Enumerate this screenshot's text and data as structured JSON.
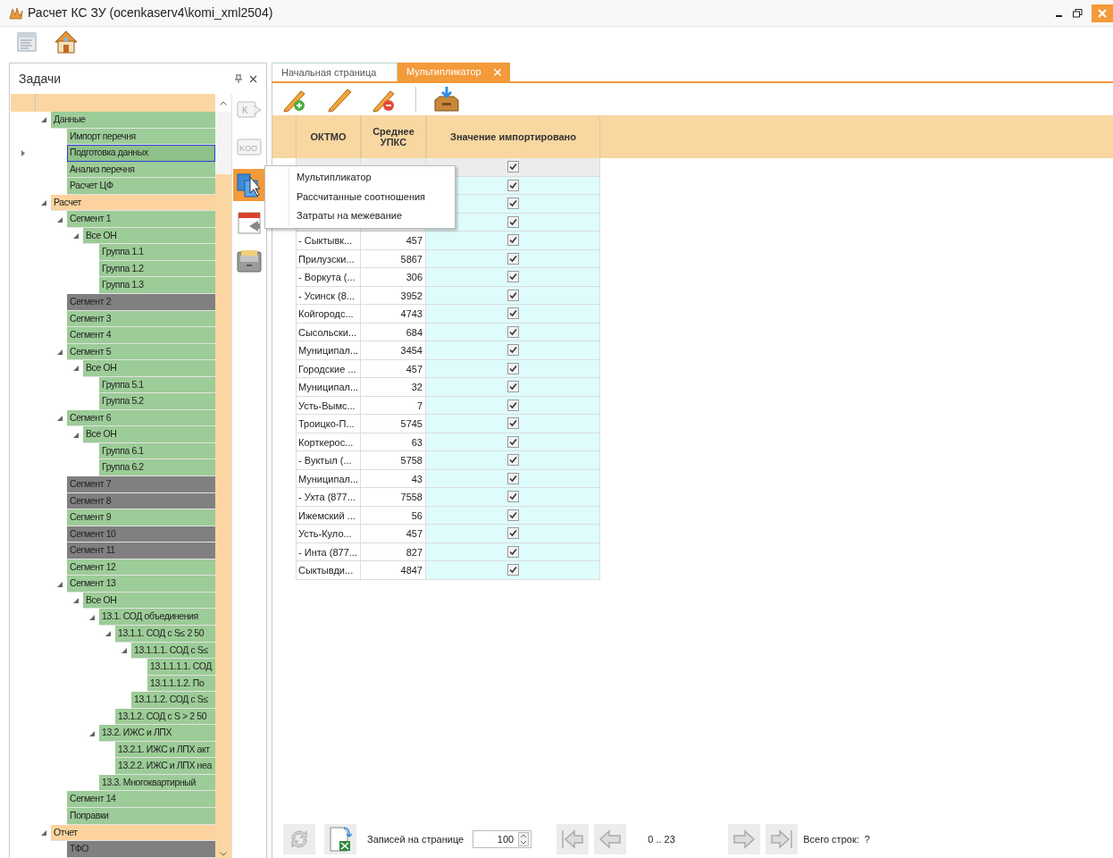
{
  "window": {
    "title": "Расчет КС ЗУ (ocenkaserv4\\komi_xml2504)"
  },
  "tasks_panel": {
    "title": "Задачи",
    "tree": [
      {
        "label": "Данные",
        "color": "#9ccc97",
        "expanded": true,
        "selected": false,
        "children": [
          {
            "label": "Импорт перечня",
            "color": "#9ccc97",
            "selected": false
          },
          {
            "label": "Подготовка данных",
            "color": "#8fc18a",
            "selected": true
          },
          {
            "label": "Анализ перечня",
            "color": "#9ccc97",
            "selected": false
          },
          {
            "label": "Расчет ЦФ",
            "color": "#9ccc97",
            "selected": false
          }
        ]
      },
      {
        "label": "Расчет",
        "color": "#fcd39e",
        "expanded": true,
        "selected": false,
        "children": [
          {
            "label": "Сегмент 1",
            "color": "#9ccc97",
            "expanded": true,
            "selected": false,
            "children": [
              {
                "label": "Все ОН",
                "color": "#9ccc97",
                "expanded": true,
                "selected": false,
                "children": [
                  {
                    "label": "Группа 1.1",
                    "color": "#9ccc97",
                    "selected": false
                  },
                  {
                    "label": "Группа 1.2",
                    "color": "#9ccc97",
                    "selected": false
                  },
                  {
                    "label": "Группа 1.3",
                    "color": "#9ccc97",
                    "selected": false
                  }
                ]
              }
            ]
          },
          {
            "label": "Сегмент 2",
            "color": "#808080",
            "selected": false
          },
          {
            "label": "Сегмент 3",
            "color": "#9ccc97",
            "selected": false
          },
          {
            "label": "Сегмент 4",
            "color": "#9ccc97",
            "selected": false
          },
          {
            "label": "Сегмент 5",
            "color": "#9ccc97",
            "expanded": true,
            "selected": false,
            "children": [
              {
                "label": "Все ОН",
                "color": "#9ccc97",
                "expanded": true,
                "selected": false,
                "children": [
                  {
                    "label": "Группа 5.1",
                    "color": "#9ccc97",
                    "selected": false
                  },
                  {
                    "label": "Группа 5.2",
                    "color": "#9ccc97",
                    "selected": false
                  }
                ]
              }
            ]
          },
          {
            "label": "Сегмент 6",
            "color": "#9ccc97",
            "expanded": true,
            "selected": false,
            "children": [
              {
                "label": "Все ОН",
                "color": "#9ccc97",
                "expanded": true,
                "selected": false,
                "children": [
                  {
                    "label": "Группа 6.1",
                    "color": "#9ccc97",
                    "selected": false
                  },
                  {
                    "label": "Группа 6.2",
                    "color": "#9ccc97",
                    "selected": false
                  }
                ]
              }
            ]
          },
          {
            "label": "Сегмент 7",
            "color": "#808080",
            "selected": false
          },
          {
            "label": "Сегмент 8",
            "color": "#808080",
            "selected": false
          },
          {
            "label": "Сегмент 9",
            "color": "#9ccc97",
            "selected": false
          },
          {
            "label": "Сегмент 10",
            "color": "#808080",
            "selected": false
          },
          {
            "label": "Сегмент 11",
            "color": "#808080",
            "selected": false
          },
          {
            "label": "Сегмент 12",
            "color": "#9ccc97",
            "selected": false
          },
          {
            "label": "Сегмент 13",
            "color": "#9ccc97",
            "expanded": true,
            "selected": false,
            "children": [
              {
                "label": "Все ОН",
                "color": "#9ccc97",
                "expanded": true,
                "selected": false,
                "children": [
                  {
                    "label": "13.1. СОД объединения",
                    "color": "#9ccc97",
                    "expanded": true,
                    "selected": false,
                    "children": [
                      {
                        "label": "13.1.1. СОД с S≤ 2 50",
                        "color": "#9ccc97",
                        "expanded": true,
                        "selected": false,
                        "children": [
                          {
                            "label": "13.1.1.1. СОД с S≤",
                            "color": "#9ccc97",
                            "expanded": true,
                            "selected": false,
                            "children": [
                              {
                                "label": "13.1.1.1.1. СОД",
                                "color": "#9ccc97",
                                "selected": false
                              },
                              {
                                "label": "13.1.1.1.2. По",
                                "color": "#9ccc97",
                                "selected": false
                              }
                            ]
                          },
                          {
                            "label": "13.1.1.2. СОД с S≤",
                            "color": "#9ccc97",
                            "selected": false
                          }
                        ]
                      },
                      {
                        "label": "13.1.2. СОД с S > 2 50",
                        "color": "#9ccc97",
                        "selected": false
                      }
                    ]
                  },
                  {
                    "label": "13.2. ИЖС и ЛПХ",
                    "color": "#9ccc97",
                    "expanded": true,
                    "selected": false,
                    "children": [
                      {
                        "label": "13.2.1. ИЖС и ЛПХ акт",
                        "color": "#9ccc97",
                        "selected": false
                      },
                      {
                        "label": "13.2.2. ИЖС и ЛПХ неа",
                        "color": "#9ccc97",
                        "selected": false
                      }
                    ]
                  },
                  {
                    "label": "13.3. Многоквартирный",
                    "color": "#9ccc97",
                    "selected": false
                  }
                ]
              }
            ]
          },
          {
            "label": "Сегмент 14",
            "color": "#9ccc97",
            "selected": false
          },
          {
            "label": "Поправки",
            "color": "#9ccc97",
            "selected": false
          }
        ]
      },
      {
        "label": "Отчет",
        "color": "#fcd39e",
        "expanded": true,
        "selected": false,
        "children": [
          {
            "label": "ТФО",
            "color": "#808080",
            "selected": false
          }
        ]
      }
    ],
    "side_tools": [
      {
        "glyph": "K",
        "selected": false
      },
      {
        "glyph": "KOO",
        "selected": false
      },
      {
        "selected": true
      },
      {
        "selected": false
      },
      {
        "selected": false
      }
    ]
  },
  "tabs": [
    {
      "label": "Начальная страница",
      "selected": false,
      "closable": false
    },
    {
      "label": "Мультипликатор",
      "selected": true,
      "closable": true
    }
  ],
  "table": {
    "columns": [
      "ОКТМО",
      "Среднее УПКС",
      "Значение импортировано"
    ],
    "rows": [
      {
        "imported": true,
        "selected": true
      },
      {
        "imported": true,
        "selected": false
      },
      {
        "imported": true,
        "selected": false
      },
      {
        "imported": true,
        "selected": false
      },
      {
        "oktmo": "- Сыктывк...",
        "upks": "457",
        "imported": true,
        "selected": false
      },
      {
        "oktmo": "Прилузски...",
        "upks": "5867",
        "imported": true,
        "selected": false
      },
      {
        "oktmo": "- Воркута (...",
        "upks": "306",
        "imported": true,
        "selected": false
      },
      {
        "oktmo": "- Усинск (8...",
        "upks": "3952",
        "imported": true,
        "selected": false
      },
      {
        "oktmo": "Койгородс...",
        "upks": "4743",
        "imported": true,
        "selected": false
      },
      {
        "oktmo": "Сысольски...",
        "upks": "684",
        "imported": true,
        "selected": false
      },
      {
        "oktmo": "Муниципал...",
        "upks": "3454",
        "imported": true,
        "selected": false
      },
      {
        "oktmo": "Городские ...",
        "upks": "457",
        "imported": true,
        "selected": false
      },
      {
        "oktmo": "Муниципал...",
        "upks": "32",
        "imported": true,
        "selected": false
      },
      {
        "oktmo": "Усть-Вымс...",
        "upks": "7",
        "imported": true,
        "selected": false
      },
      {
        "oktmo": "Троицко-П...",
        "upks": "5745",
        "imported": true,
        "selected": false
      },
      {
        "oktmo": "Корткерос...",
        "upks": "63",
        "imported": true,
        "selected": false
      },
      {
        "oktmo": "- Вуктыл (...",
        "upks": "5758",
        "imported": true,
        "selected": false
      },
      {
        "oktmo": "Муниципал...",
        "upks": "43",
        "imported": true,
        "selected": false
      },
      {
        "oktmo": "- Ухта (877...",
        "upks": "7558",
        "imported": true,
        "selected": false
      },
      {
        "oktmo": "Ижемский ...",
        "upks": "56",
        "imported": true,
        "selected": false
      },
      {
        "oktmo": "Усть-Куло...",
        "upks": "457",
        "imported": true,
        "selected": false
      },
      {
        "oktmo": "- Инта (877...",
        "upks": "827",
        "imported": true,
        "selected": false
      },
      {
        "oktmo": "Сыктывди...",
        "upks": "4847",
        "imported": true,
        "selected": false
      }
    ]
  },
  "context_menu": [
    "Мультипликатор",
    "Рассчитанные соотношения",
    "Затраты на межевание"
  ],
  "pager": {
    "page_size_label": "Записей на странице",
    "page_size": "100",
    "range": "0 .. 23",
    "total_label": "Всего строк:",
    "total": "?"
  }
}
